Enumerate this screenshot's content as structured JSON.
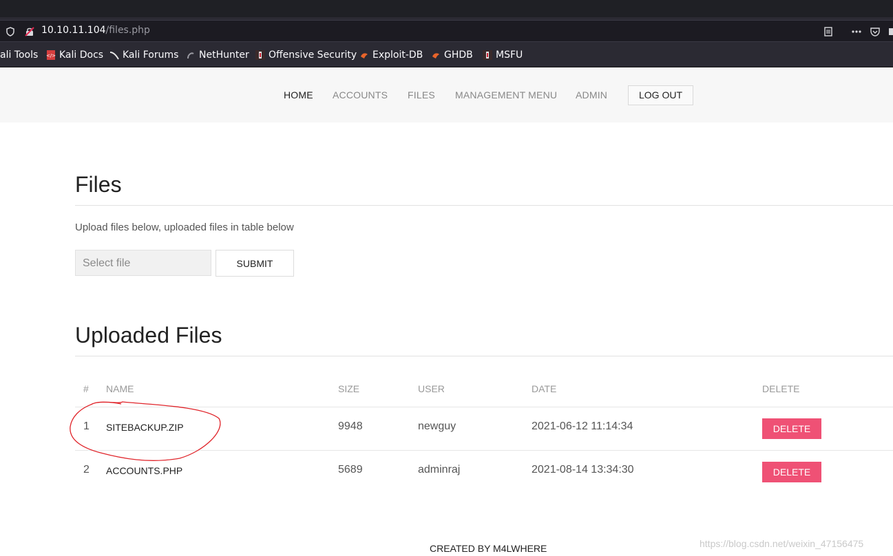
{
  "browser": {
    "url_host": "10.10.11.104",
    "url_path": "/files.php",
    "bookmarks": [
      {
        "label": "ali Tools",
        "icon": "kali-icon"
      },
      {
        "label": "Kali Docs",
        "icon": "kali-docs-icon"
      },
      {
        "label": "Kali Forums",
        "icon": "kali-forums-icon"
      },
      {
        "label": "NetHunter",
        "icon": "nethunter-icon"
      },
      {
        "label": "Offensive Security",
        "icon": "offsec-icon"
      },
      {
        "label": "Exploit-DB",
        "icon": "exploitdb-icon"
      },
      {
        "label": "GHDB",
        "icon": "ghdb-icon"
      },
      {
        "label": "MSFU",
        "icon": "msfu-icon"
      }
    ]
  },
  "nav": {
    "items": [
      "HOME",
      "ACCOUNTS",
      "FILES",
      "MANAGEMENT MENU",
      "ADMIN"
    ],
    "logout": "LOG OUT"
  },
  "files_section": {
    "title": "Files",
    "subtitle": "Upload files below, uploaded files in table below",
    "file_placeholder": "Select file",
    "submit_label": "SUBMIT"
  },
  "uploaded": {
    "title": "Uploaded Files",
    "headers": [
      "#",
      "NAME",
      "SIZE",
      "USER",
      "DATE",
      "DELETE"
    ],
    "rows": [
      {
        "num": "1",
        "name": "SITEBACKUP.ZIP",
        "size": "9948",
        "user": "newguy",
        "date": "2021-06-12 11:14:34",
        "action": "DELETE"
      },
      {
        "num": "2",
        "name": "ACCOUNTS.PHP",
        "size": "5689",
        "user": "adminraj",
        "date": "2021-08-14 13:34:30",
        "action": "DELETE"
      }
    ]
  },
  "footer": "CREATED BY M4LWHERE",
  "watermark": "https://blog.csdn.net/weixin_47156475",
  "colors": {
    "delete_button": "#ef5175",
    "nav_bg": "#f7f7f7",
    "browser_chrome": "#2b2a33"
  }
}
